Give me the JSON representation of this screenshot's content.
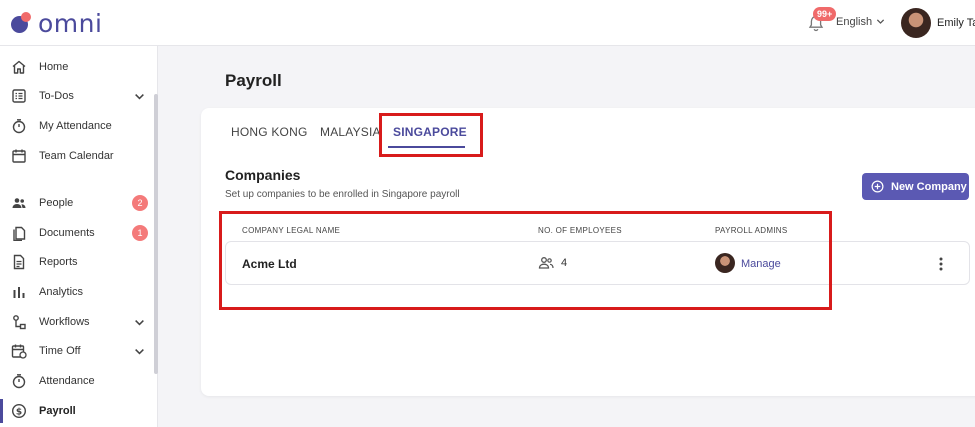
{
  "app": {
    "logo_text": "omni"
  },
  "header": {
    "notification_count": "99+",
    "language": "English",
    "user_name": "Emily Tan"
  },
  "sidebar": {
    "items": [
      {
        "label": "Home",
        "icon": "home-icon"
      },
      {
        "label": "To-Dos",
        "icon": "checklist-icon",
        "expandable": true
      },
      {
        "label": "My Attendance",
        "icon": "stopwatch-icon"
      },
      {
        "label": "Team Calendar",
        "icon": "calendar-icon"
      },
      {
        "label": "People",
        "icon": "people-icon",
        "count": "2"
      },
      {
        "label": "Documents",
        "icon": "documents-icon",
        "count": "1"
      },
      {
        "label": "Reports",
        "icon": "report-icon"
      },
      {
        "label": "Analytics",
        "icon": "bar-chart-icon"
      },
      {
        "label": "Workflows",
        "icon": "workflow-icon",
        "expandable": true
      },
      {
        "label": "Time Off",
        "icon": "calendar-clock-icon",
        "expandable": true
      },
      {
        "label": "Attendance",
        "icon": "stopwatch-icon"
      },
      {
        "label": "Payroll",
        "icon": "dollar-icon",
        "active": true
      }
    ]
  },
  "main": {
    "title": "Payroll",
    "tabs": [
      {
        "label": "HONG KONG"
      },
      {
        "label": "MALAYSIA"
      },
      {
        "label": "SINGAPORE",
        "active": true
      }
    ],
    "section": {
      "title": "Companies",
      "subtitle": "Set up companies to be enrolled in Singapore payroll",
      "new_button": "New Company"
    },
    "table": {
      "headers": [
        "COMPANY LEGAL NAME",
        "NO. OF EMPLOYEES",
        "PAYROLL ADMINS"
      ],
      "rows": [
        {
          "company": "Acme Ltd",
          "employees": "4",
          "admin_action": "Manage"
        }
      ]
    }
  },
  "colors": {
    "accent": "#4b4a9c",
    "button": "#5b59b3",
    "badge": "#f06a6a",
    "highlight": "#d81b1b"
  }
}
